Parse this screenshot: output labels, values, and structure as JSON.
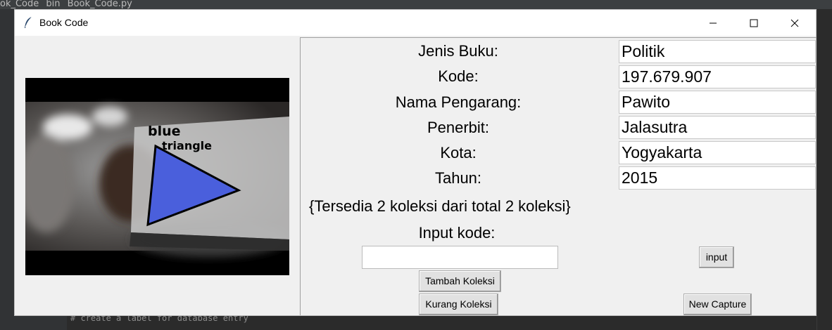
{
  "ide": {
    "breadcrumb": [
      "ok_Code",
      "bin",
      "Book_Code.py"
    ],
    "code_snippet": "# create a label for database entry"
  },
  "window": {
    "title": "Book Code"
  },
  "camera": {
    "overlay_color_label": "blue",
    "overlay_shape_label": "triangle"
  },
  "fields": [
    {
      "label": "Jenis Buku:",
      "value": "Politik"
    },
    {
      "label": "Kode:",
      "value": "197.679.907"
    },
    {
      "label": "Nama Pengarang:",
      "value": "Pawito"
    },
    {
      "label": "Penerbit:",
      "value": "Jalasutra"
    },
    {
      "label": "Kota:",
      "value": "Yogyakarta"
    },
    {
      "label": "Tahun:",
      "value": "2015"
    }
  ],
  "status_text": "{Tersedia 2 koleksi dari total 2 koleksi}",
  "input_section": {
    "label": "Input kode:",
    "value": "",
    "input_button": "input",
    "add_button": "Tambah Koleksi",
    "remove_button": "Kurang Koleksi",
    "capture_button": "New Capture"
  },
  "colors": {
    "shape_fill": "#4a5fdc",
    "window_bg": "#f0f0f0"
  }
}
